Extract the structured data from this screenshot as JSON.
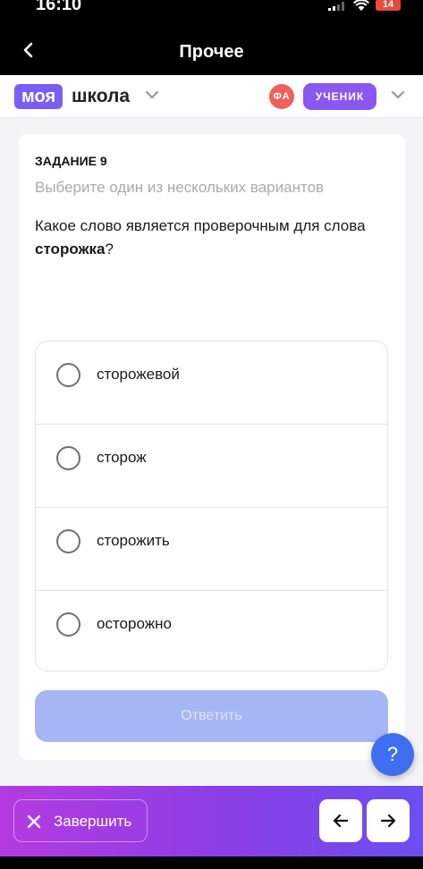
{
  "status_bar": {
    "time": "16:10",
    "battery": "14"
  },
  "nav": {
    "title": "Прочее"
  },
  "header": {
    "logo_part1": "моя",
    "logo_part2": "школа",
    "avatar_initials": "ФА",
    "role": "УЧЕНИК"
  },
  "task": {
    "number": "ЗАДАНИЕ 9",
    "hint": "Выберите один из нескольких вариантов",
    "question_prefix": "Какое слово является проверочным для слова ",
    "question_word": "сторожка",
    "question_suffix": "?",
    "options": [
      {
        "label": "сторожевой",
        "selected": false
      },
      {
        "label": "сторож",
        "selected": false
      },
      {
        "label": "сторожить",
        "selected": false
      },
      {
        "label": "осторожно",
        "selected": false
      }
    ],
    "answer_button": "Ответить"
  },
  "help_button": "?",
  "footer": {
    "finish_label": "Завершить"
  },
  "colors": {
    "brand": "#7b5cf5",
    "role": "#8a58f0",
    "answer_disabled": "#a6b6f5",
    "help": "#3f6ef0"
  }
}
